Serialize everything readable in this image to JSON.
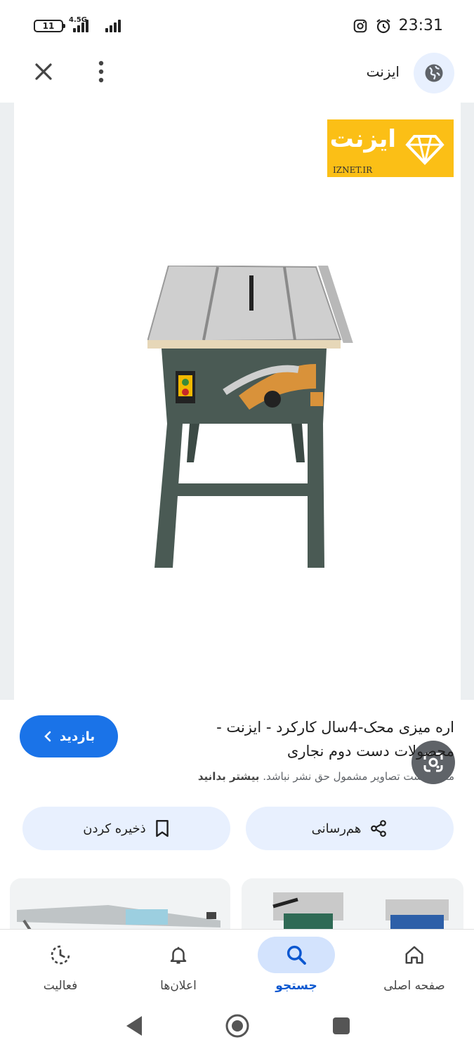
{
  "status_bar": {
    "battery": "11",
    "network": "4.5G",
    "time": "23:31",
    "icons": [
      "instagram-icon",
      "alarm-icon"
    ]
  },
  "header": {
    "site_name": "ایزنت",
    "close_icon": "close-icon",
    "more_icon": "more-vert-icon",
    "globe_icon": "globe-icon"
  },
  "image": {
    "logo_text": "ایزنت",
    "logo_url": "IZNET.IR",
    "lens_icon": "google-lens-icon"
  },
  "result": {
    "title": "اره میزی محک-4سال کارکرد - ایزنت - محصولات دست دوم نجاری",
    "notice_text": "ممکن است تصاویر مشمول حق نشر نباشد.",
    "notice_link": "بیشتر بدانید",
    "visit_label": "بازدید"
  },
  "actions": {
    "share_label": "هم‌رسانی",
    "save_label": "ذخیره کردن"
  },
  "bottom_nav": {
    "items": [
      {
        "label": "صفحه اصلی",
        "icon": "home-icon"
      },
      {
        "label": "جستجو",
        "icon": "search-icon",
        "active": true
      },
      {
        "label": "اعلان‌ها",
        "icon": "bell-icon"
      },
      {
        "label": "فعالیت",
        "icon": "activity-icon"
      }
    ]
  },
  "colors": {
    "accent": "#1a73e8",
    "pill_bg": "#e8f0fe",
    "logo_bg": "#fbbf16"
  }
}
